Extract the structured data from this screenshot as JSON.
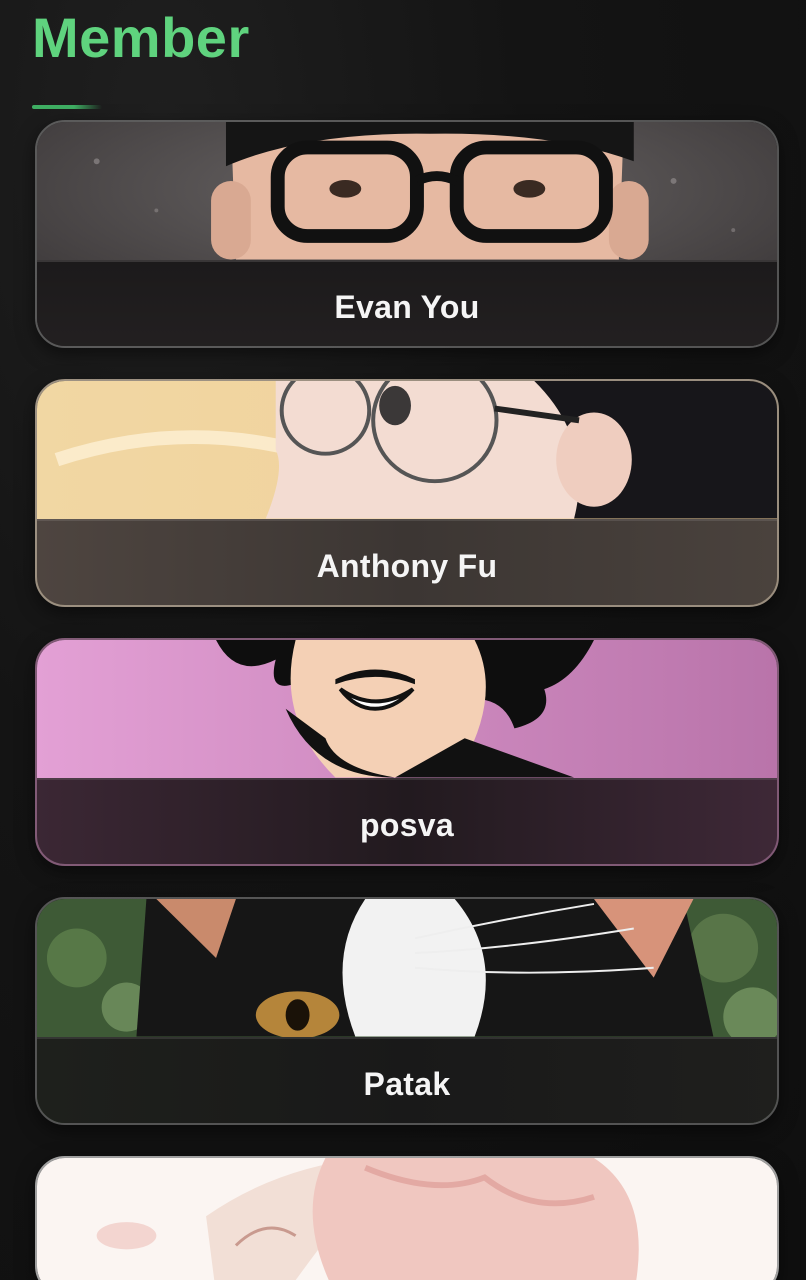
{
  "section": {
    "title": "Member"
  },
  "members": [
    {
      "name": "Evan You",
      "avatar_icon": "person-with-glasses-photo"
    },
    {
      "name": "Anthony Fu",
      "avatar_icon": "anime-person-with-glasses"
    },
    {
      "name": "posva",
      "avatar_icon": "cartoon-person-with-beard"
    },
    {
      "name": "Patak",
      "avatar_icon": "cat-photo"
    },
    {
      "name": "",
      "avatar_icon": "anime-pink-hair-portrait"
    }
  ],
  "colors": {
    "accent": "#5fd37e",
    "background": "#121212",
    "card_text": "#f5f5f5"
  }
}
